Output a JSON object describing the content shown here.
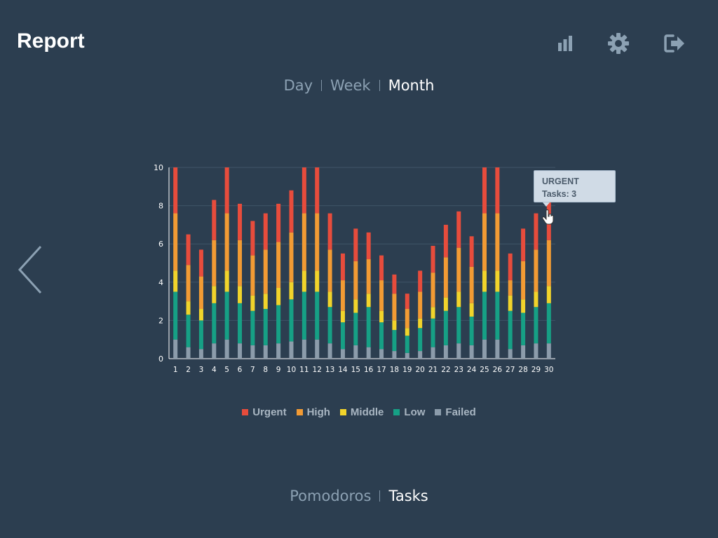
{
  "header": {
    "title": "Report",
    "icons": [
      "bar-chart-icon",
      "gear-icon",
      "logout-icon"
    ]
  },
  "period_tabs": [
    {
      "label": "Day",
      "active": false
    },
    {
      "label": "Week",
      "active": false
    },
    {
      "label": "Month",
      "active": true
    }
  ],
  "view_tabs": [
    {
      "label": "Pomodoros",
      "active": false
    },
    {
      "label": "Tasks",
      "active": true
    }
  ],
  "tooltip": {
    "title": "URGENT",
    "value_text": "Tasks: 3"
  },
  "colors": {
    "background": "#2c3e50",
    "urgent": "#e74c3c",
    "high": "#f29b34",
    "middle": "#f1d42b",
    "low": "#16a085",
    "failed": "#8c9cab",
    "axis": "#ffffff",
    "grid": "#3f5467"
  },
  "chart_data": {
    "type": "bar",
    "stacked": true,
    "categories": [
      "1",
      "2",
      "3",
      "4",
      "5",
      "6",
      "7",
      "8",
      "9",
      "10",
      "11",
      "12",
      "13",
      "14",
      "15",
      "16",
      "17",
      "18",
      "19",
      "20",
      "21",
      "22",
      "23",
      "24",
      "25",
      "26",
      "27",
      "28",
      "29",
      "30"
    ],
    "ylim": [
      0,
      10
    ],
    "yticks": [
      0,
      2,
      4,
      6,
      8,
      10
    ],
    "grid": true,
    "legend_position": "bottom",
    "series": [
      {
        "name": "Failed",
        "color": "#8c9cab",
        "values": [
          1,
          0.6,
          0.5,
          0.8,
          1,
          0.8,
          0.7,
          0.7,
          0.8,
          0.9,
          1,
          1,
          0.8,
          0.5,
          0.7,
          0.6,
          0.5,
          0.4,
          0.3,
          0.4,
          0.6,
          0.7,
          0.8,
          0.7,
          1,
          1,
          0.5,
          0.7,
          0.8,
          0.8
        ]
      },
      {
        "name": "Low",
        "color": "#16a085",
        "values": [
          2.5,
          1.7,
          1.5,
          2.1,
          2.5,
          2.1,
          1.8,
          1.9,
          2,
          2.2,
          2.5,
          2.5,
          1.9,
          1.4,
          1.7,
          2.1,
          1.4,
          1.1,
          0.9,
          1.2,
          1.5,
          1.8,
          1.9,
          1.5,
          2.5,
          2.5,
          2,
          1.7,
          1.9,
          2.1
        ]
      },
      {
        "name": "Middle",
        "color": "#f1d42b",
        "values": [
          1.1,
          0.7,
          0.6,
          0.9,
          1.1,
          0.9,
          0.8,
          0.8,
          0.9,
          0.9,
          1.1,
          1.1,
          0.8,
          0.6,
          0.7,
          0.7,
          0.6,
          0.5,
          0.4,
          0.5,
          0.6,
          0.7,
          0.8,
          0.7,
          1.1,
          1.1,
          0.8,
          0.7,
          0.8,
          0.9
        ]
      },
      {
        "name": "High",
        "color": "#f29b34",
        "values": [
          3,
          1.9,
          1.7,
          2.4,
          3,
          2.4,
          2.1,
          2.3,
          2.4,
          2.6,
          3,
          3,
          2.2,
          1.6,
          2,
          1.8,
          1.6,
          1.4,
          1,
          1.4,
          1.8,
          2.1,
          2.3,
          1.9,
          3,
          3,
          0.8,
          2,
          2.2,
          2.4
        ]
      },
      {
        "name": "Urgent",
        "color": "#e74c3c",
        "values": [
          2.4,
          1.6,
          1.4,
          2.1,
          2.4,
          1.9,
          1.8,
          1.9,
          2,
          2.2,
          2.4,
          2.4,
          1.9,
          1.4,
          1.7,
          1.4,
          1.3,
          1,
          0.8,
          1.1,
          1.4,
          1.7,
          1.9,
          1.6,
          2.4,
          2.4,
          1.4,
          1.7,
          1.9,
          3
        ]
      }
    ],
    "legend": [
      "Urgent",
      "High",
      "Middle",
      "Low",
      "Failed"
    ]
  }
}
